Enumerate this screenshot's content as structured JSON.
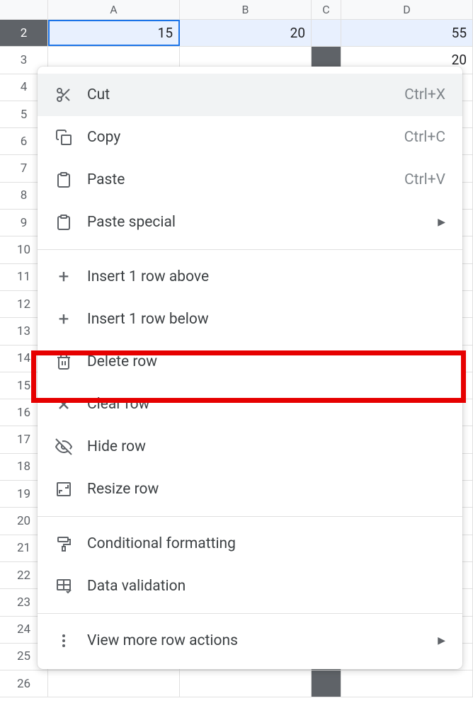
{
  "columns": {
    "a": "A",
    "b": "B",
    "c": "C",
    "d": "D"
  },
  "rows": [
    "2",
    "3",
    "4",
    "5",
    "6",
    "7",
    "8",
    "9",
    "10",
    "11",
    "12",
    "13",
    "14",
    "15",
    "16",
    "17",
    "18",
    "19",
    "20",
    "21",
    "22",
    "23",
    "24",
    "25",
    "26"
  ],
  "cells": {
    "r2a": "15",
    "r2b": "20",
    "r2d": "55",
    "r3d": "20"
  },
  "menu": {
    "cut": "Cut",
    "cut_shortcut": "Ctrl+X",
    "copy": "Copy",
    "copy_shortcut": "Ctrl+C",
    "paste": "Paste",
    "paste_shortcut": "Ctrl+V",
    "paste_special": "Paste special",
    "insert_above": "Insert 1 row above",
    "insert_below": "Insert 1 row below",
    "delete_row": "Delete row",
    "clear_row": "Clear row",
    "hide_row": "Hide row",
    "resize_row": "Resize row",
    "conditional_formatting": "Conditional formatting",
    "data_validation": "Data validation",
    "view_more": "View more row actions"
  }
}
